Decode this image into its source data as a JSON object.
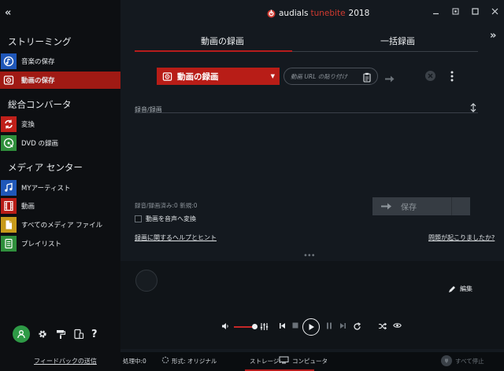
{
  "app": {
    "brand_word": "audials",
    "brand_product": "tunebite",
    "brand_year": "2018"
  },
  "sidebar": {
    "sections": [
      {
        "label": "ストリーミング"
      },
      {
        "label": "総合コンバータ"
      },
      {
        "label": "メディア センター"
      }
    ],
    "items": [
      {
        "label": "音楽の保存",
        "icon": "music-save-icon",
        "color": "#1f57b8",
        "active": false
      },
      {
        "label": "動画の保存",
        "icon": "video-save-icon",
        "color": "#a01a14",
        "active": true
      },
      {
        "label": "変換",
        "icon": "convert-icon",
        "color": "#c0201a",
        "active": false
      },
      {
        "label": "DVD の録画",
        "icon": "dvd-record-icon",
        "color": "#2f8f3c",
        "active": false
      },
      {
        "label": "MYアーティスト",
        "icon": "artist-icon",
        "color": "#1f57b8",
        "active": false
      },
      {
        "label": "動画",
        "icon": "film-icon",
        "color": "#b81d17",
        "active": false
      },
      {
        "label": "すべてのメディア ファイル",
        "icon": "file-icon",
        "color": "#c79a1a",
        "active": false
      },
      {
        "label": "プレイリスト",
        "icon": "playlist-icon",
        "color": "#2f8f3c",
        "active": false
      }
    ],
    "bottom_icons": [
      "user-icon",
      "settings-icon",
      "paint-roller-icon",
      "devices-icon",
      "help-icon"
    ],
    "help_glyph": "?",
    "feedback_label": "フィードバックの送信"
  },
  "main": {
    "tabs": [
      {
        "label": "動画の録画",
        "active": true
      },
      {
        "label": "一括録画",
        "active": false
      }
    ],
    "record_button_label": "動画の録画",
    "url_placeholder": "動画 URL の貼り付け",
    "list_header": "録音/録画",
    "stats_text": "録音/録画済み:0   新規:0",
    "convert_audio_label": "動画を音声へ変換",
    "convert_audio_checked": false,
    "save_label": "保存",
    "help_link": "録画に関するヘルプとヒント",
    "problem_link": "問題が起こりましたか?"
  },
  "player": {
    "edit_label": "編集",
    "volume_fraction": 0.9
  },
  "statusbar": {
    "processing": "処理中:0",
    "format": "形式: オリジナル",
    "storage_label": "ストレージ:",
    "storage_value": "コンピュータ",
    "stop_all": "すべて停止"
  },
  "colors": {
    "accent": "#b71c1c",
    "sidebar_bg": "#0d0f12",
    "main_bg": "#14191f"
  }
}
